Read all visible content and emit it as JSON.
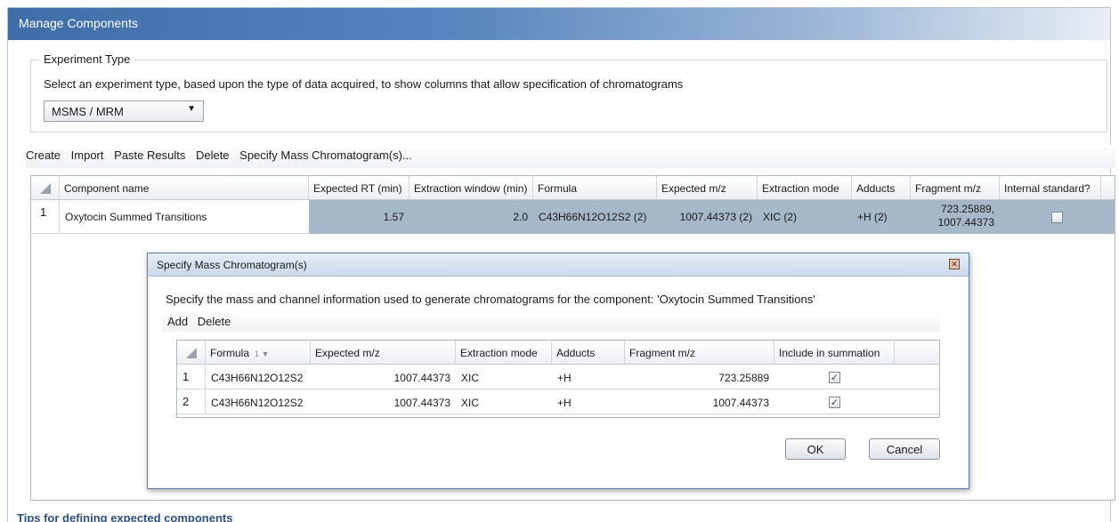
{
  "window": {
    "title": "Manage Components"
  },
  "experiment_type": {
    "legend": "Experiment Type",
    "description": "Select an experiment type, based upon the type of data acquired, to show columns that allow specification of chromatograms",
    "selected": "MSMS / MRM"
  },
  "toolbar": {
    "create": "Create",
    "import": "Import",
    "paste_results": "Paste Results",
    "delete": "Delete",
    "specify_mass": "Specify Mass Chromatogram(s)..."
  },
  "components_table": {
    "columns": [
      "Component name",
      "Expected RT (min)",
      "Extraction window (min)",
      "Formula",
      "Expected m/z",
      "Extraction mode",
      "Adducts",
      "Fragment m/z",
      "Internal standard?"
    ],
    "rows": [
      {
        "num": "1",
        "component_name": "Oxytocin Summed Transitions",
        "expected_rt": "1.57",
        "extraction_window": "2.0",
        "formula": "C43H66N12O12S2 (2)",
        "expected_mz": "1007.44373 (2)",
        "extraction_mode": "XIC (2)",
        "adducts": "+H (2)",
        "fragment_mz_line1": "723.25889,",
        "fragment_mz_line2": "1007.44373",
        "internal_standard": false
      }
    ]
  },
  "dialog": {
    "title": "Specify Mass Chromatogram(s)",
    "description": "Specify the mass and channel information used to generate chromatograms for the component: 'Oxytocin Summed Transitions'",
    "toolbar": {
      "add": "Add",
      "delete": "Delete"
    },
    "columns": [
      "Formula",
      "Expected m/z",
      "Extraction mode",
      "Adducts",
      "Fragment m/z",
      "Include in summation"
    ],
    "sort_indicator": "1",
    "rows": [
      {
        "num": "1",
        "formula": "C43H66N12O12S2",
        "expected_mz": "1007.44373",
        "extraction_mode": "XIC",
        "adducts": "+H",
        "fragment_mz": "723.25889",
        "include": true
      },
      {
        "num": "2",
        "formula": "C43H66N12O12S2",
        "expected_mz": "1007.44373",
        "extraction_mode": "XIC",
        "adducts": "+H",
        "fragment_mz": "1007.44373",
        "include": true
      }
    ],
    "ok": "OK",
    "cancel": "Cancel"
  },
  "tips_link": "Tips for defining expected components",
  "colors": {
    "title_gradient_start": "#3f6da8",
    "selection": "#a7b8c8",
    "link": "#2b4f86"
  }
}
